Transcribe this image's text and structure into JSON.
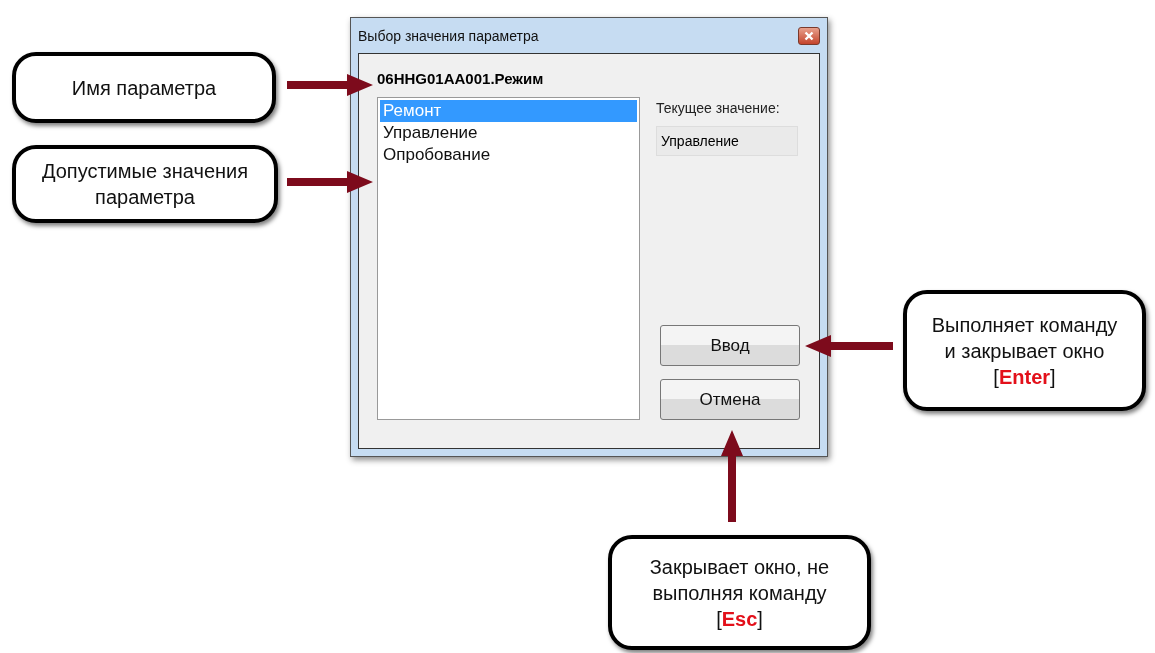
{
  "dialog": {
    "title": "Выбор значения параметра",
    "parameter_name": "06HHG01AA001.Режим",
    "values": [
      {
        "label": "Ремонт",
        "selected": true
      },
      {
        "label": "Управление",
        "selected": false
      },
      {
        "label": "Опробование",
        "selected": false
      }
    ],
    "current_value": {
      "label": "Текущее значение:",
      "value": "Управление"
    },
    "buttons": [
      {
        "label": "Ввод"
      },
      {
        "label": "Отмена"
      }
    ]
  },
  "callouts": [
    {
      "text": "Имя параметра"
    },
    {
      "text": "Допустимые значения\nпараметра"
    },
    {
      "text": "Выполняет команду\nи закрывает окно\n[**Enter**]"
    },
    {
      "text": "Закрывает окно, не\nвыполняя команду\n[**Esc**]"
    }
  ]
}
